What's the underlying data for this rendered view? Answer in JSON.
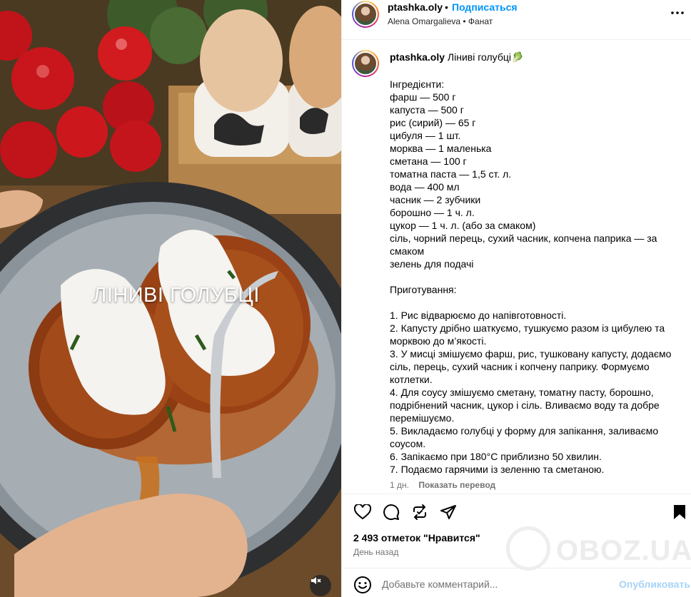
{
  "media": {
    "overlay_text": "ЛІНИВІ ГОЛУБЦІ",
    "mute_icon": "speaker-muted-icon"
  },
  "header": {
    "username": "ptashka.oly",
    "separator": "•",
    "follow_label": "Подписаться",
    "subtitle": "Alena Omargalieva • Фанат",
    "more_icon": "more-horizontal-icon"
  },
  "caption": {
    "username": "ptashka.oly",
    "title": "Ліниві голубці",
    "title_emoji": "🥬",
    "body": "Інгредієнти:\nфарш — 500 г\nкапуста — 500 г\nрис (сирий) — 65 г\nцибуля — 1 шт.\nморква — 1 маленька\nсметана — 100 г\nтоматна паста — 1,5 ст. л.\nвода — 400 мл\nчасник — 2 зубчики\nборошно — 1 ч. л.\nцукор — 1 ч. л. (або за смаком)\nсіль, чорний перець, сухий часник, копчена паприка — за смаком\nзелень для подачі\n\nПриготування:\n\n1. Рис відварюємо до напівготовності.\n2. Капусту дрібно шаткуємо, тушкуємо разом із цибулею та морквою до м’якості.\n3. У мисці змішуємо фарш, рис, тушковану капусту, додаємо сіль, перець, сухий часник і копчену паприку. Формуємо котлетки.\n4. Для соусу змішуємо сметану, томатну пасту, борошно, подрібнений часник, цукор і сіль. Вливаємо воду та добре перемішуємо.\n5. Викладаємо голубці у форму для запікання, заливаємо соусом.\n6. Запікаємо при 180°C приблизно 50 хвилин.\n7. Подаємо гарячими із зеленню та сметаною.",
    "age": "1 дн.",
    "translate_label": "Показать перевод"
  },
  "actions": {
    "like_icon": "heart-icon",
    "comment_icon": "comment-icon",
    "share_icon": "repost-icon",
    "send_icon": "send-icon",
    "save_icon": "bookmark-icon"
  },
  "likes_text": "2 493 отметок \"Нравится\"",
  "date_text": "День назад",
  "comment": {
    "placeholder": "Добавьте комментарий...",
    "publish_label": "Опубликовать",
    "emoji_icon": "emoji-icon"
  },
  "watermark": {
    "text": "OBOZ.UA"
  },
  "colors": {
    "accent": "#0095f6",
    "publish_disabled": "#a6d3f7",
    "muted_text": "#737373",
    "divider": "#efefef"
  }
}
